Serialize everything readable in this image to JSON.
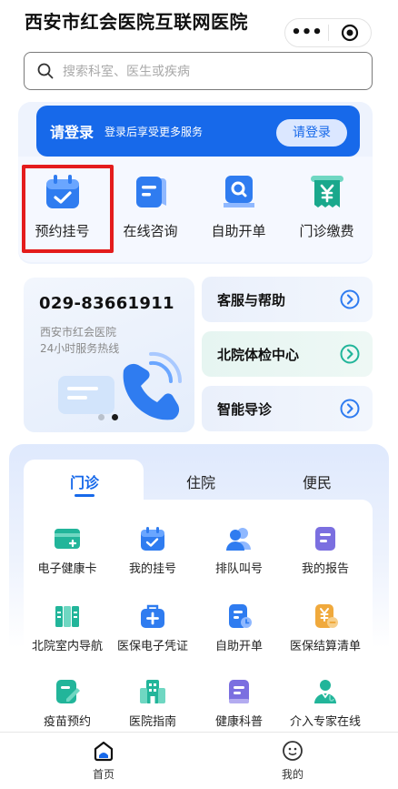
{
  "header": {
    "title": "西安市红会医院互联网医院",
    "capsule_more": "•••"
  },
  "search": {
    "placeholder": "搜索科室、医生或疾病"
  },
  "login_banner": {
    "title": "请登录",
    "subtitle": "登录后享受更多服务",
    "button": "请登录"
  },
  "quick_actions": [
    {
      "label": "预约挂号",
      "icon": "calendar-check-icon"
    },
    {
      "label": "在线咨询",
      "icon": "chat-doc-icon"
    },
    {
      "label": "自助开单",
      "icon": "search-doc-icon"
    },
    {
      "label": "门诊缴费",
      "icon": "yuan-ticket-icon"
    }
  ],
  "hotline": {
    "number": "029-83661911",
    "line1": "西安市红会医院",
    "line2": "24小时服务热线"
  },
  "side_cards": [
    {
      "label": "客服与帮助"
    },
    {
      "label": "北院体检中心"
    },
    {
      "label": "智能导诊"
    }
  ],
  "tabs": [
    {
      "label": "门诊",
      "active": true
    },
    {
      "label": "住院",
      "active": false
    },
    {
      "label": "便民",
      "active": false
    }
  ],
  "services": [
    {
      "label": "电子健康卡",
      "icon": "health-card-icon",
      "color": "#22b59a"
    },
    {
      "label": "我的挂号",
      "icon": "calendar-check-icon",
      "color": "#2f7cf0"
    },
    {
      "label": "排队叫号",
      "icon": "queue-people-icon",
      "color": "#2f7cf0"
    },
    {
      "label": "我的报告",
      "icon": "report-icon",
      "color": "#7b6fe0"
    },
    {
      "label": "北院室内导航",
      "icon": "map-nav-icon",
      "color": "#22b59a"
    },
    {
      "label": "医保电子凭证",
      "icon": "medkit-plus-icon",
      "color": "#2f7cf0"
    },
    {
      "label": "自助开单",
      "icon": "order-doc-icon",
      "color": "#2f7cf0"
    },
    {
      "label": "医保结算清单",
      "icon": "yuan-doc-icon",
      "color": "#f0a93c"
    },
    {
      "label": "疫苗预约",
      "icon": "vaccine-edit-icon",
      "color": "#22b59a"
    },
    {
      "label": "医院指南",
      "icon": "hospital-building-icon",
      "color": "#22b59a"
    },
    {
      "label": "健康科普",
      "icon": "book-doc-icon",
      "color": "#7b6fe0"
    },
    {
      "label": "介入专家在线",
      "icon": "doctor-icon",
      "color": "#22b59a"
    }
  ],
  "bottom_nav": [
    {
      "label": "首页",
      "icon": "home-icon",
      "active": true
    },
    {
      "label": "我的",
      "icon": "smile-face-icon",
      "active": false
    }
  ],
  "colors": {
    "primary": "#1769ea",
    "highlight": "#e41c1c",
    "teal": "#22b59a"
  }
}
